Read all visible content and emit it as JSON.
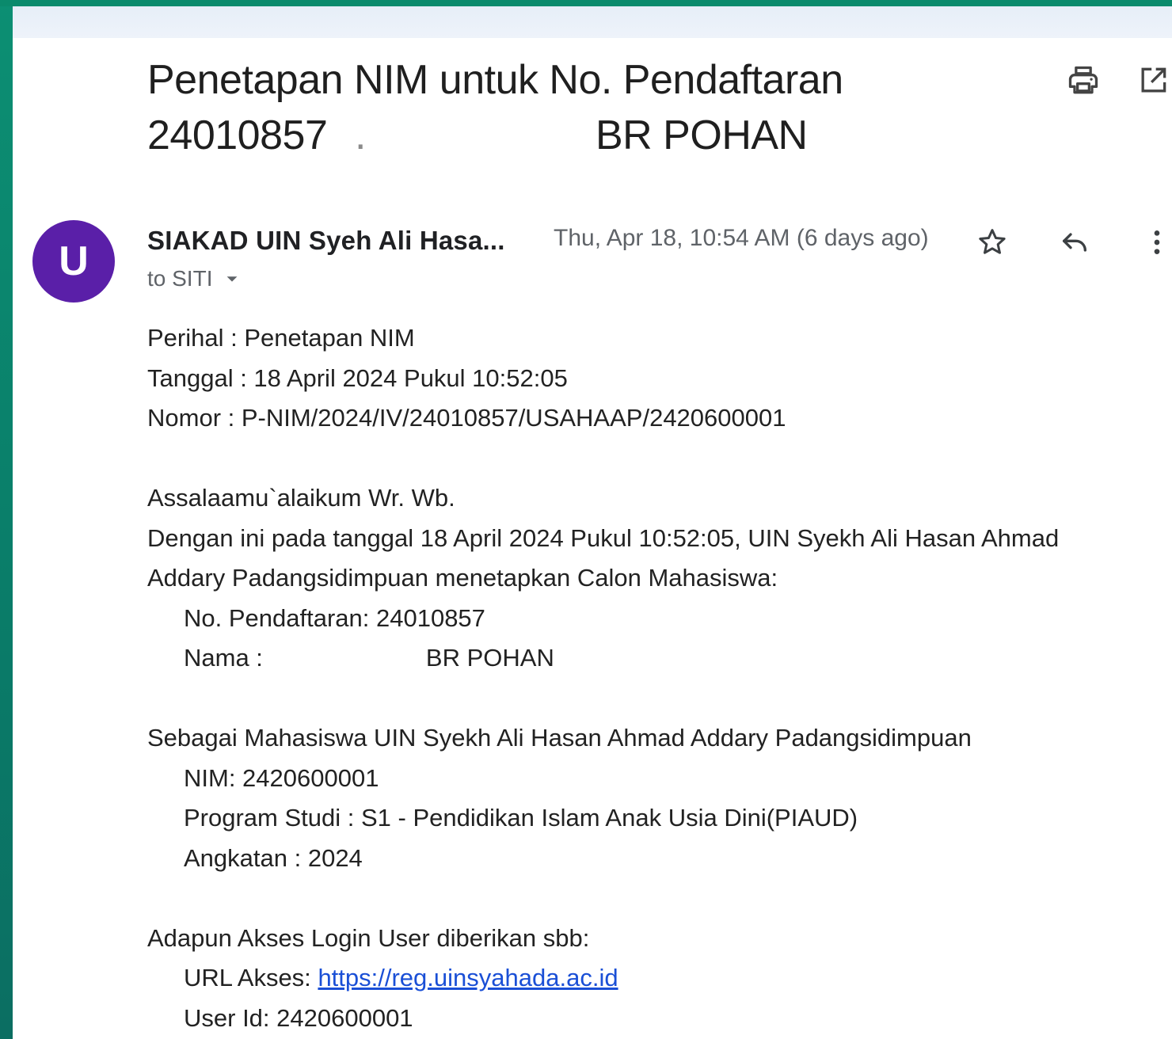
{
  "email": {
    "subject_line1": "Penetapan NIM untuk No. Pendaftaran",
    "subject_reg": "24010857",
    "subject_dot": ".",
    "subject_name": "BR POHAN",
    "sender": "SIAKAD UIN Syeh Ali Hasa...",
    "date": "Thu, Apr 18, 10:54 AM (6 days ago)",
    "to": "to SITI",
    "avatar_letter": "U",
    "avatar_color": "#5a1fa8",
    "icons": [
      "print-icon",
      "open-in-new-window-icon",
      "star-icon",
      "reply-icon",
      "more-vert-icon",
      "dropdown-arrow-icon"
    ]
  },
  "body": {
    "perihal": "Perihal : Penetapan NIM",
    "tanggal": "Tanggal : 18 April 2024 Pukul 10:52:05",
    "nomor": "Nomor : P-NIM/2024/IV/24010857/USAHAAP/2420600001",
    "greeting": "Assalaamu`alaikum Wr. Wb.",
    "intro1": "Dengan ini pada tanggal 18 April 2024 Pukul 10:52:05, UIN Syekh Ali Hasan Ahmad",
    "intro2": "Addary Padangsidimpuan menetapkan Calon Mahasiswa:",
    "reg_no": "No. Pendaftaran: 24010857",
    "name_label": "Nama :",
    "name_value": "BR POHAN",
    "as_student": "Sebagai Mahasiswa UIN Syekh Ali Hasan Ahmad Addary Padangsidimpuan",
    "nim": "NIM: 2420600001",
    "program": "Program Studi : S1 - Pendidikan Islam Anak Usia Dini(PIAUD)",
    "angkatan": "Angkatan : 2024",
    "access_intro": "Adapun Akses Login User diberikan sbb:",
    "url_label": "URL Akses:",
    "url": "https://reg.uinsyahada.ac.id",
    "user_id": "User Id: 2420600001"
  }
}
